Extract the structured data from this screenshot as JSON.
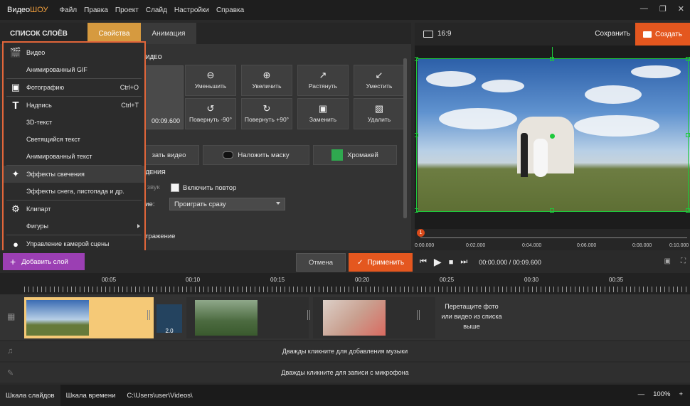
{
  "app": {
    "logo_part1": "Видео",
    "logo_part2": "ШОУ"
  },
  "menu": [
    "Файл",
    "Правка",
    "Проект",
    "Слайд",
    "Настройки",
    "Справка"
  ],
  "window_controls": {
    "minimize": "—",
    "restore": "❐",
    "close": "✕"
  },
  "left_header": {
    "layers_title": "СПИСОК СЛОЁВ",
    "tab_properties": "Свойства",
    "tab_animation": "Анимация"
  },
  "props": {
    "video_section": "ВИДЕО",
    "duration": "00:09.600",
    "tools": [
      {
        "icon": "zoom-out",
        "label": "Уменьшить"
      },
      {
        "icon": "zoom-in",
        "label": "Увеличить"
      },
      {
        "icon": "stretch",
        "label": "Растянуть"
      },
      {
        "icon": "fit",
        "label": "Уместить"
      },
      {
        "icon": "rotate-left",
        "label": "Повернуть -90°"
      },
      {
        "icon": "rotate-right",
        "label": "Повернуть +90°"
      },
      {
        "icon": "replace",
        "label": "Заменить"
      },
      {
        "icon": "delete",
        "label": "Удалить"
      }
    ],
    "wide_buttons": {
      "edit": "зать видео",
      "mask": "Наложить маску",
      "chroma": "Хромакей"
    },
    "play_section": "ЕДЕНИЯ",
    "sound_label": "ь звук",
    "loop_label": "Включить повтор",
    "play_label": "ние:",
    "play_select": "Проиграть сразу",
    "extra_section": "Я",
    "mirror_label": "отражение"
  },
  "dropdown": [
    {
      "icon": "clapper",
      "label": "Видео",
      "shortcut": ""
    },
    {
      "icon": "",
      "label": "Анимированный GIF",
      "shortcut": ""
    },
    {
      "icon": "image",
      "label": "Фотографию",
      "shortcut": "Ctrl+O"
    },
    {
      "icon": "text",
      "label": "Надпись",
      "shortcut": "Ctrl+T"
    },
    {
      "icon": "",
      "label": "3D-текст",
      "shortcut": ""
    },
    {
      "icon": "",
      "label": "Светящийся текст",
      "shortcut": ""
    },
    {
      "icon": "",
      "label": "Анимированный текст",
      "shortcut": ""
    },
    {
      "icon": "magic-wand",
      "label": "Эффекты свечения",
      "shortcut": ""
    },
    {
      "icon": "",
      "label": "Эффекты снега, листопада и др.",
      "shortcut": ""
    },
    {
      "icon": "gear",
      "label": "Клипарт",
      "shortcut": ""
    },
    {
      "icon": "",
      "label": "Фигуры",
      "shortcut": ""
    },
    {
      "icon": "camera",
      "label": "Управление камерой сцены",
      "shortcut": ""
    }
  ],
  "right_header": {
    "ratio": "16:9",
    "save": "Сохранить",
    "create": "Создать"
  },
  "preview_ruler": {
    "marker": "1",
    "ticks": [
      "0:00.000",
      "0:02.000",
      "0:04.000",
      "0:06.000",
      "0:08.000",
      "0:10.000"
    ]
  },
  "actions": {
    "add_layer": "Добавить слой",
    "cancel": "Отмена",
    "apply": "Применить"
  },
  "player": {
    "time": "00:00.000 / 00:09.600"
  },
  "timeline": {
    "ticks": [
      "00:05",
      "00:10",
      "00:15",
      "00:20",
      "00:25",
      "00:30",
      "00:35"
    ],
    "transition_duration": "2.0",
    "drop_hint": "Перетащите фото или видео из списка выше",
    "music_hint": "Дважды кликните для добавления музыки",
    "mic_hint": "Дважды кликните для записи с микрофона"
  },
  "status": {
    "slides_tab": "Шкала слайдов",
    "timeline_tab": "Шкала времени",
    "path": "C:\\Users\\user\\Videos\\",
    "zoom": "100%"
  },
  "colors": {
    "accent_orange": "#e4571f",
    "tab_active": "#d69a3f",
    "add_layer_purple": "#9b3fb3",
    "guide_green": "#1dc93b"
  }
}
